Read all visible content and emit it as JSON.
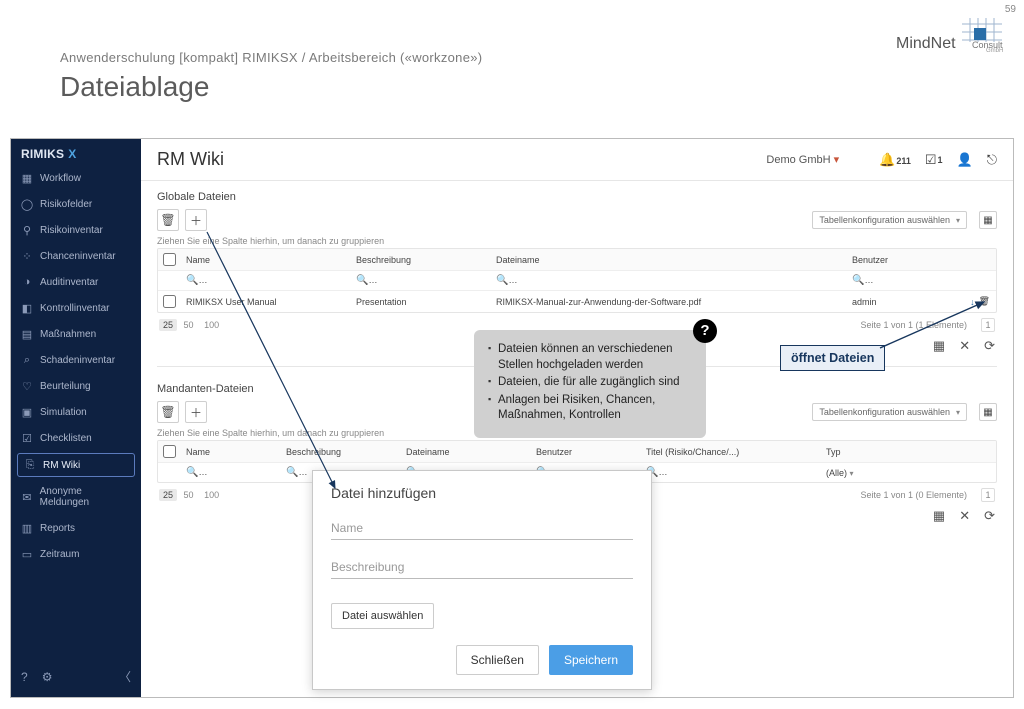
{
  "slide": {
    "page_number": "59",
    "breadcrumb": "Anwenderschulung [kompakt] RIMIKSX / Arbeitsbereich («workzone»)",
    "title": "Dateiablage",
    "brand": "MindNet",
    "brand_suffix": "Consult",
    "brand_sub": "GmbH"
  },
  "sidebar": {
    "brand": "RIMIKS",
    "items": [
      {
        "label": "Workflow"
      },
      {
        "label": "Risikofelder"
      },
      {
        "label": "Risikoinventar"
      },
      {
        "label": "Chanceninventar"
      },
      {
        "label": "Auditinventar"
      },
      {
        "label": "Kontrollinventar"
      },
      {
        "label": "Maßnahmen"
      },
      {
        "label": "Schadeninventar"
      },
      {
        "label": "Beurteilung"
      },
      {
        "label": "Simulation"
      },
      {
        "label": "Checklisten"
      },
      {
        "label": "RM Wiki"
      },
      {
        "label": "Anonyme Meldungen"
      },
      {
        "label": "Reports"
      },
      {
        "label": "Zeitraum"
      }
    ]
  },
  "topbar": {
    "title": "RM Wiki",
    "org": "Demo GmbH",
    "bell_count": "211",
    "check_count": "1"
  },
  "global": {
    "section_title": "Globale Dateien",
    "config_placeholder": "Tabellenkonfiguration auswählen",
    "group_hint": "Ziehen Sie eine Spalte hierhin, um danach zu gruppieren",
    "headers": {
      "name": "Name",
      "desc": "Beschreibung",
      "file": "Dateiname",
      "user": "Benutzer"
    },
    "row": {
      "name": "RIMIKSX User Manual",
      "desc": "Presentation",
      "file": "RIMIKSX-Manual-zur-Anwendung-der-Software.pdf",
      "user": "admin"
    },
    "page_sizes": [
      "25",
      "50",
      "100"
    ],
    "page_info": "Seite 1 von 1 (1 Elemente)",
    "page_current": "1"
  },
  "tenant": {
    "section_title": "Mandanten-Dateien",
    "config_placeholder": "Tabellenkonfiguration auswählen",
    "group_hint": "Ziehen Sie eine Spalte hierhin, um danach zu gruppieren",
    "headers": {
      "name": "Name",
      "desc": "Beschreibung",
      "file": "Dateiname",
      "user": "Benutzer",
      "title": "Titel (Risiko/Chance/...)",
      "type": "Typ"
    },
    "type_filter": "(Alle)",
    "page_sizes": [
      "25",
      "50",
      "100"
    ],
    "page_info": "Seite 1 von 1 (0 Elemente)",
    "page_current": "1"
  },
  "modal": {
    "title": "Datei hinzufügen",
    "ph_name": "Name",
    "ph_desc": "Beschreibung",
    "choose": "Datei auswählen",
    "close": "Schließen",
    "save": "Speichern"
  },
  "bubble": {
    "items": [
      "Dateien können an verschiedenen Stellen hochgeladen werden",
      "Dateien, die für alle zugänglich sind",
      "Anlagen bei Risiken, Chancen, Maßnahmen, Kontrollen"
    ]
  },
  "anno": {
    "label": "öffnet Dateien"
  }
}
